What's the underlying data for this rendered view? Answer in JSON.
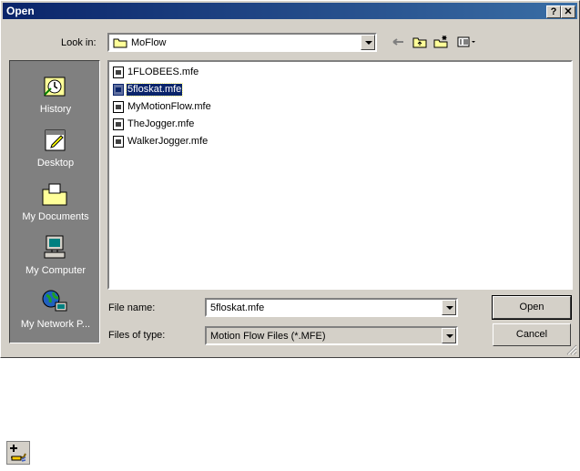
{
  "dialog": {
    "title": "Open",
    "help_glyph": "?",
    "close_glyph": "✕"
  },
  "look_in": {
    "label": "Look in:",
    "value": "MoFlow",
    "icons": [
      "back-arrow-icon",
      "up-one-level-icon",
      "new-folder-icon",
      "view-menu-icon"
    ]
  },
  "places": [
    {
      "label": "History",
      "icon": "history-icon"
    },
    {
      "label": "Desktop",
      "icon": "desktop-icon"
    },
    {
      "label": "My Documents",
      "icon": "my-documents-icon"
    },
    {
      "label": "My Computer",
      "icon": "my-computer-icon"
    },
    {
      "label": "My Network P...",
      "icon": "my-network-places-icon"
    }
  ],
  "files": [
    {
      "name": "1FLOBEES.mfe",
      "selected": false
    },
    {
      "name": "5floskat.mfe",
      "selected": true
    },
    {
      "name": "MyMotionFlow.mfe",
      "selected": false
    },
    {
      "name": "TheJogger.mfe",
      "selected": false
    },
    {
      "name": "WalkerJogger.mfe",
      "selected": false
    }
  ],
  "file_name": {
    "label": "File name:",
    "value": "5floskat.mfe"
  },
  "files_of_type": {
    "label": "Files of type:",
    "value": "Motion Flow Files (*.MFE)"
  },
  "buttons": {
    "open": "Open",
    "cancel": "Cancel"
  },
  "colors": {
    "title_bar": "#0a246a",
    "face": "#d4d0c8",
    "places_bg": "#808080",
    "selection": "#0a246a"
  }
}
